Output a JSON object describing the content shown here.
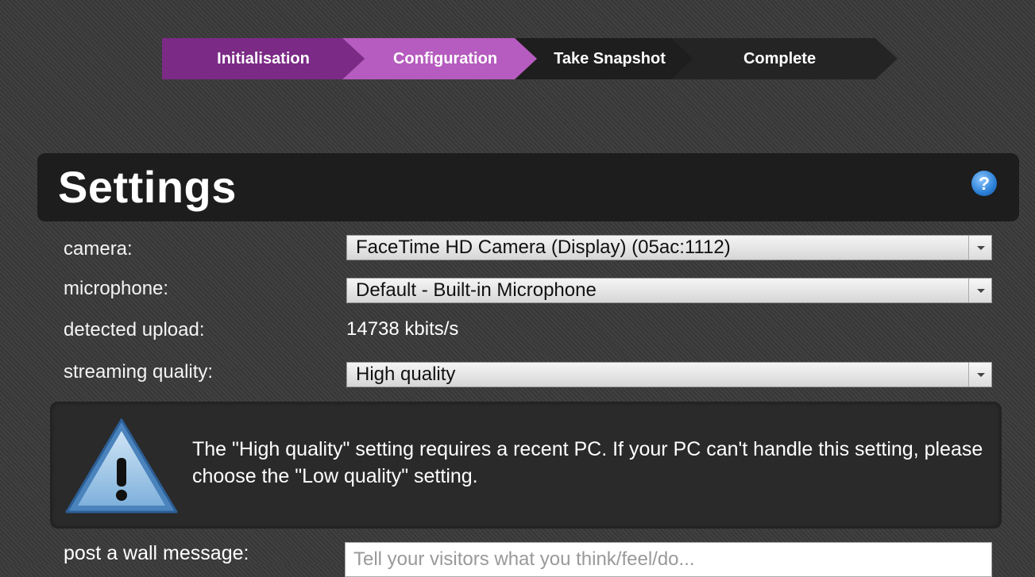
{
  "stepper": {
    "steps": [
      {
        "label": "Initialisation",
        "state": "done",
        "color": "#7b2a86"
      },
      {
        "label": "Configuration",
        "state": "active",
        "color": "#b65bbf"
      },
      {
        "label": "Take Snapshot",
        "state": "pending",
        "color": "#1e1e1e"
      },
      {
        "label": "Complete",
        "state": "pending",
        "color": "#242424"
      }
    ]
  },
  "settings": {
    "title": "Settings",
    "help_icon": "?",
    "camera": {
      "label": "camera:",
      "value": "FaceTime HD Camera (Display) (05ac:1112)"
    },
    "microphone": {
      "label": "microphone:",
      "value": "Default - Built-in Microphone"
    },
    "upload": {
      "label": "detected upload:",
      "value": "14738 kbits/s"
    },
    "quality": {
      "label": "streaming quality:",
      "value": "High quality"
    },
    "warning": {
      "icon": "warning-triangle-icon",
      "text": "The \"High quality\" setting requires a recent PC. If your PC can't handle this setting, please choose the \"Low quality\" setting."
    },
    "wall_message": {
      "label": "post a wall message:",
      "placeholder": "Tell your visitors what you think/feel/do..."
    }
  }
}
